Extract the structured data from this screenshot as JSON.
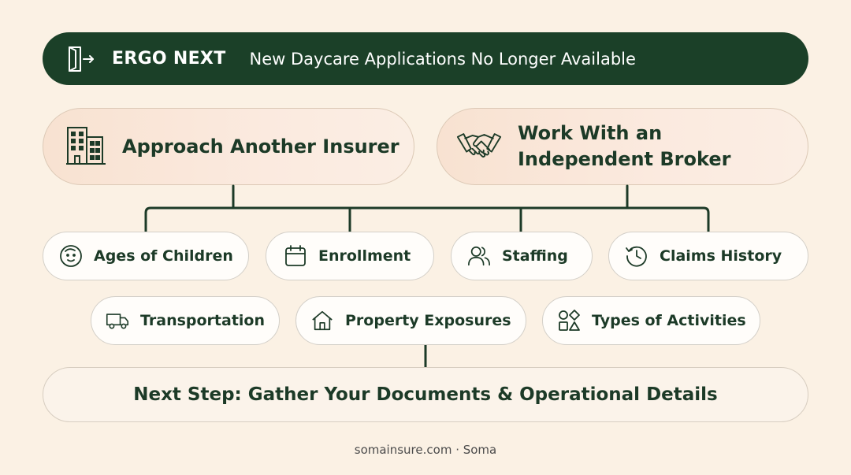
{
  "banner": {
    "brand": "ERGO NEXT",
    "headline": "New Daycare Applications No Longer Available",
    "icon": "exit-door-icon"
  },
  "options": [
    {
      "label": "Approach Another Insurer",
      "icon": "office-buildings-icon"
    },
    {
      "label_line1": "Work With an",
      "label_line2": "Independent Broker",
      "icon": "handshake-icon"
    }
  ],
  "factors": [
    {
      "label": "Ages of Children",
      "icon": "child-face-icon"
    },
    {
      "label": "Enrollment",
      "icon": "calendar-icon"
    },
    {
      "label": "Staffing",
      "icon": "people-icon"
    },
    {
      "label": "Claims History",
      "icon": "history-clock-icon"
    },
    {
      "label": "Transportation",
      "icon": "truck-icon"
    },
    {
      "label": "Property Exposures",
      "icon": "house-icon"
    },
    {
      "label": "Types of Activities",
      "icon": "shapes-icon"
    }
  ],
  "next_step": {
    "label": "Next Step: Gather Your Documents & Operational Details"
  },
  "footer": {
    "text": "somainsure.com · Soma"
  },
  "colors": {
    "background": "#fbf1e4",
    "banner": "#1b4028",
    "ink": "#1c3a27",
    "connector": "#1c3a27"
  }
}
